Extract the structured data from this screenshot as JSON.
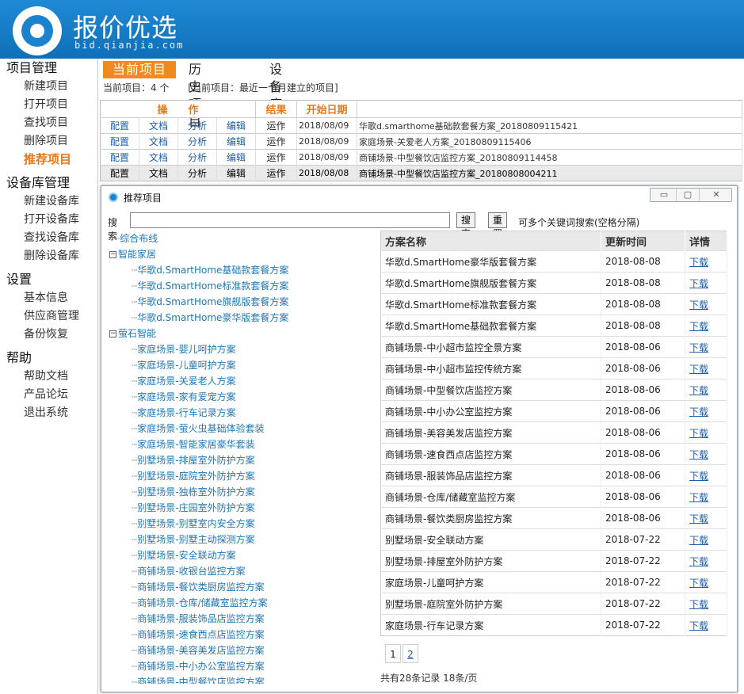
{
  "header": {
    "title": "报价优选",
    "url": "bid.qianjia.com"
  },
  "sidebar": {
    "groups": [
      {
        "title": "项目管理",
        "items": [
          "新建项目",
          "打开项目",
          "查找项目",
          "删除项目",
          "推荐项目"
        ]
      },
      {
        "title": "设备库管理",
        "items": [
          "新建设备库",
          "打开设备库",
          "查找设备库",
          "删除设备库"
        ]
      },
      {
        "title": "设置",
        "items": [
          "基本信息",
          "供应商管理",
          "备份恢复"
        ]
      },
      {
        "title": "帮助",
        "items": [
          "帮助文档",
          "产品论坛",
          "退出系统"
        ]
      }
    ],
    "active_item": "推荐项目"
  },
  "tabs": [
    "当前项目",
    "历史项目",
    "设 备 库"
  ],
  "current_info": {
    "count": "当前项目：4 个",
    "desc": "[当前项目：最近一个月建立的项目]"
  },
  "project_table": {
    "headers": {
      "op": "操　　作",
      "result": "结果",
      "start_date": "开始日期"
    },
    "ops": [
      "配置",
      "文档",
      "分析",
      "编辑"
    ],
    "rows": [
      {
        "result": "运作",
        "date": "2018/08/09",
        "name": "华歌d.smarthome基础款套餐方案_20180809115421"
      },
      {
        "result": "运作",
        "date": "2018/08/09",
        "name": "家庭场景-关爱老人方案_20180809115406"
      },
      {
        "result": "运作",
        "date": "2018/08/09",
        "name": "商铺场景-中型餐饮店监控方案_20180809114458"
      },
      {
        "result": "运作",
        "date": "2018/08/08",
        "name": "商铺场景-中型餐饮店监控方案_20180808004211"
      }
    ]
  },
  "dialog": {
    "title": "推荐项目",
    "window_buttons": {
      "min": "▭",
      "max": "▢",
      "close": "✕"
    },
    "search": {
      "label": "搜索",
      "value": "",
      "search_button": "搜索",
      "reset_button": "重置",
      "hint": "可多个关键词搜索(空格分隔)"
    },
    "tree": [
      {
        "type": "lvl0",
        "label": "综合布线"
      },
      {
        "type": "grp",
        "label": "智能家居"
      },
      {
        "type": "leaf",
        "label": "华歌d.SmartHome基础款套餐方案"
      },
      {
        "type": "leaf",
        "label": "华歌d.SmartHome标准款套餐方案"
      },
      {
        "type": "leaf",
        "label": "华歌d.SmartHome旗舰版套餐方案"
      },
      {
        "type": "leaf",
        "label": "华歌d.SmartHome豪华版套餐方案"
      },
      {
        "type": "grp",
        "label": "萤石智能"
      },
      {
        "type": "leaf",
        "label": "家庭场景-婴儿呵护方案"
      },
      {
        "type": "leaf",
        "label": "家庭场景-儿童呵护方案"
      },
      {
        "type": "leaf",
        "label": "家庭场景-关爱老人方案"
      },
      {
        "type": "leaf",
        "label": "家庭场景-家有爱宠方案"
      },
      {
        "type": "leaf",
        "label": "家庭场景-行车记录方案"
      },
      {
        "type": "leaf",
        "label": "家庭场景-萤火虫基础体验套装"
      },
      {
        "type": "leaf",
        "label": "家庭场景-智能家居豪华套装"
      },
      {
        "type": "leaf",
        "label": "别墅场景-排屋室外防护方案"
      },
      {
        "type": "leaf",
        "label": "别墅场景-庭院室外防护方案"
      },
      {
        "type": "leaf",
        "label": "别墅场景-独栋室外防护方案"
      },
      {
        "type": "leaf",
        "label": "别墅场景-庄园室外防护方案"
      },
      {
        "type": "leaf",
        "label": "别墅场景-别墅室内安全方案"
      },
      {
        "type": "leaf",
        "label": "别墅场景-别墅主动探测方案"
      },
      {
        "type": "leaf",
        "label": "别墅场景-安全联动方案"
      },
      {
        "type": "leaf",
        "label": "商铺场景-收银台监控方案"
      },
      {
        "type": "leaf",
        "label": "商铺场景-餐饮类厨房监控方案"
      },
      {
        "type": "leaf",
        "label": "商铺场景-仓库/储藏室监控方案"
      },
      {
        "type": "leaf",
        "label": "商铺场景-服装饰品店监控方案"
      },
      {
        "type": "leaf",
        "label": "商铺场景-速食西点店监控方案"
      },
      {
        "type": "leaf",
        "label": "商铺场景-美容美发店监控方案"
      },
      {
        "type": "leaf",
        "label": "商铺场景-中小办公室监控方案"
      },
      {
        "type": "leaf",
        "label": "商铺场景-中型餐饮店监控方案"
      }
    ],
    "results": {
      "headers": [
        "方案名称",
        "更新时间",
        "详情"
      ],
      "download_label": "下载",
      "rows": [
        [
          "华歌d.SmartHome豪华版套餐方案",
          "2018-08-08"
        ],
        [
          "华歌d.SmartHome旗舰版套餐方案",
          "2018-08-08"
        ],
        [
          "华歌d.SmartHome标准款套餐方案",
          "2018-08-08"
        ],
        [
          "华歌d.SmartHome基础款套餐方案",
          "2018-08-08"
        ],
        [
          "商铺场景-中小超市监控全景方案",
          "2018-08-06"
        ],
        [
          "商铺场景-中小超市监控传统方案",
          "2018-08-06"
        ],
        [
          "商铺场景-中型餐饮店监控方案",
          "2018-08-06"
        ],
        [
          "商铺场景-中小办公室监控方案",
          "2018-08-06"
        ],
        [
          "商铺场景-美容美发店监控方案",
          "2018-08-06"
        ],
        [
          "商铺场景-速食西点店监控方案",
          "2018-08-06"
        ],
        [
          "商铺场景-服装饰品店监控方案",
          "2018-08-06"
        ],
        [
          "商铺场景-仓库/储藏室监控方案",
          "2018-08-06"
        ],
        [
          "商铺场景-餐饮类厨房监控方案",
          "2018-08-06"
        ],
        [
          "别墅场景-安全联动方案",
          "2018-07-22"
        ],
        [
          "别墅场景-排屋室外防护方案",
          "2018-07-22"
        ],
        [
          "家庭场景-儿童呵护方案",
          "2018-07-22"
        ],
        [
          "别墅场景-庭院室外防护方案",
          "2018-07-22"
        ],
        [
          "家庭场景-行车记录方案",
          "2018-07-22"
        ]
      ]
    },
    "pager": {
      "pages": [
        "1",
        "2"
      ],
      "current": "1"
    },
    "record_info": "共有28条记录  18条/页"
  }
}
